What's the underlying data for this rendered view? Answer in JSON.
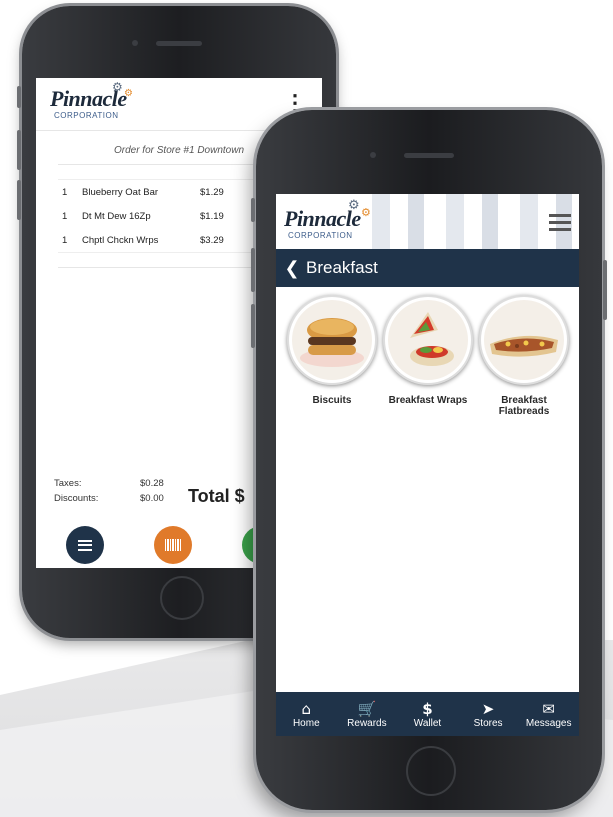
{
  "back_phone": {
    "logo": {
      "wordmark": "Pinnacle",
      "subtitle": "CORPORATION"
    },
    "order_title": "Order for Store #1 Downtown",
    "items": [
      {
        "qty": "1",
        "name": "Blueberry Oat Bar",
        "price": "$1.29"
      },
      {
        "qty": "1",
        "name": "Dt Mt Dew 16Zp",
        "price": "$1.19"
      },
      {
        "qty": "1",
        "name": "Chptl Chckn Wrps",
        "price": "$3.29"
      }
    ],
    "taxes_label": "Taxes:",
    "taxes_value": "$0.28",
    "discounts_label": "Discounts:",
    "discounts_value": "$0.00",
    "total_label": "Total $"
  },
  "front_phone": {
    "logo": {
      "wordmark": "Pinnacle",
      "subtitle": "CORPORATION"
    },
    "nav_title": "Breakfast",
    "categories": [
      {
        "label": "Biscuits"
      },
      {
        "label": "Breakfast Wraps"
      },
      {
        "label": "Breakfast Flatbreads"
      }
    ],
    "tabs": [
      {
        "label": "Home",
        "icon": "home-icon"
      },
      {
        "label": "Rewards",
        "icon": "cart-icon"
      },
      {
        "label": "Wallet",
        "icon": "dollar-icon"
      },
      {
        "label": "Stores",
        "icon": "location-arrow-icon"
      },
      {
        "label": "Messages",
        "icon": "envelope-icon"
      }
    ]
  },
  "colors": {
    "navy": "#1f3349",
    "orange": "#e07a2a",
    "green": "#3aa14a"
  }
}
